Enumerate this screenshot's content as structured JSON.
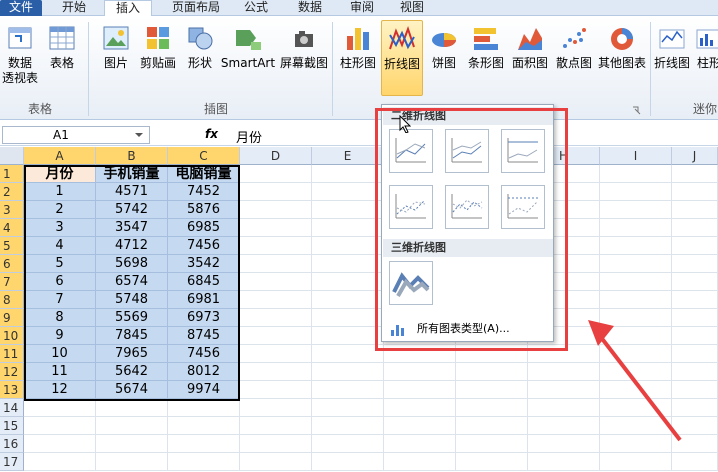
{
  "tabs": [
    {
      "label": "文件"
    },
    {
      "label": "开始"
    },
    {
      "label": "插入"
    },
    {
      "label": "页面布局"
    },
    {
      "label": "公式"
    },
    {
      "label": "数据"
    },
    {
      "label": "审阅"
    },
    {
      "label": "视图"
    }
  ],
  "ribbon": {
    "buttons": {
      "pivot": "数据",
      "pivot2": "透视表",
      "table": "表格",
      "picture": "图片",
      "clipart": "剪贴画",
      "shapes": "形状",
      "smartart": "SmartArt",
      "screenshot": "屏幕截图",
      "col": "柱形图",
      "line": "折线图",
      "pie": "饼图",
      "bar": "条形图",
      "area": "面积图",
      "scatter": "散点图",
      "other": "其他图表",
      "spark_line": "折线图",
      "spark_col": "柱形"
    },
    "groups": {
      "tables": "表格",
      "illustrations": "插图",
      "sparklines": "迷你"
    }
  },
  "formula": {
    "name_box": "A1",
    "fx": "fx",
    "value": "月份"
  },
  "sheet": {
    "columns": [
      "A",
      "B",
      "C",
      "D",
      "E",
      "F",
      "G",
      "H",
      "I",
      "J"
    ],
    "rows": [
      "1",
      "2",
      "3",
      "4",
      "5",
      "6",
      "7",
      "8",
      "9",
      "10",
      "11",
      "12",
      "13",
      "14",
      "15",
      "16",
      "17"
    ],
    "headers": [
      "月份",
      "手机销量",
      "电脑销量"
    ],
    "data": [
      [
        "1",
        "4571",
        "7452"
      ],
      [
        "2",
        "5742",
        "5876"
      ],
      [
        "3",
        "3547",
        "6985"
      ],
      [
        "4",
        "4712",
        "7456"
      ],
      [
        "5",
        "5698",
        "3542"
      ],
      [
        "6",
        "6574",
        "6845"
      ],
      [
        "7",
        "5748",
        "6981"
      ],
      [
        "8",
        "5569",
        "6973"
      ],
      [
        "9",
        "7845",
        "8745"
      ],
      [
        "10",
        "7965",
        "7456"
      ],
      [
        "11",
        "5642",
        "8012"
      ],
      [
        "12",
        "5674",
        "9974"
      ]
    ]
  },
  "dropdown": {
    "section_2d": "二维折线图",
    "section_3d": "三维折线图",
    "all_types": "所有图表类型(A)..."
  }
}
